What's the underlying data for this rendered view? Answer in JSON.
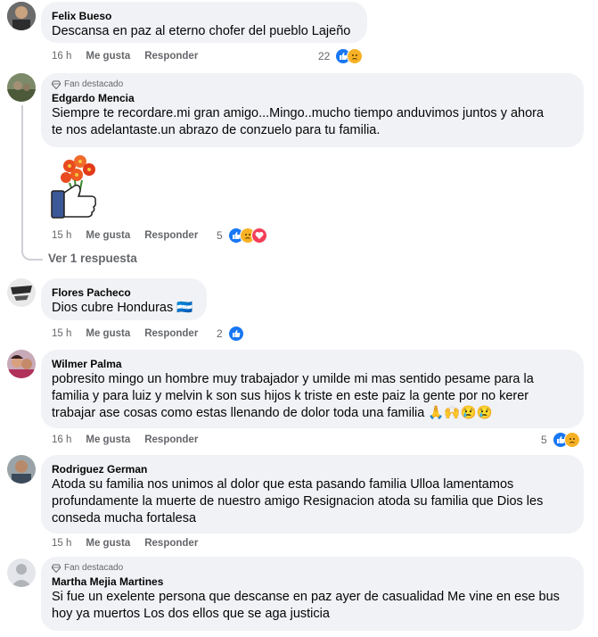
{
  "comments": [
    {
      "name": "Felix Bueso",
      "badge": "",
      "text": [
        "Descansa en paz al eterno chofer del pueblo Lajeño"
      ],
      "time": "16 h",
      "like": "Me gusta",
      "reply": "Responder",
      "count": "22"
    },
    {
      "name": "Edgardo Mencia",
      "badge": "Fan destacado",
      "text": [
        "Siempre te recordare.mi gran amigo...Mingo..mucho tiempo anduvimos juntos y ahora",
        "te nos adelantaste.un abrazo de conzuelo para tu familia."
      ],
      "time": "15 h",
      "like": "Me gusta",
      "reply": "Responder",
      "count": "5",
      "replies_link": "Ver 1 respuesta"
    },
    {
      "name": "Flores Pacheco",
      "badge": "",
      "text": [
        "Dios cubre Honduras 🇭🇳"
      ],
      "time": "15 h",
      "like": "Me gusta",
      "reply": "Responder",
      "count": "2"
    },
    {
      "name": "Wilmer Palma",
      "badge": "",
      "text": [
        "pobresito mingo un hombre muy trabajador y umilde mi mas sentido pesame para la",
        "familia y para luiz y melvin k son sus hijos k triste en este paiz la gente por no kerer",
        "trabajar ase cosas como estas llenando de dolor toda una familia 🙏🙌😢😢"
      ],
      "time": "16 h",
      "like": "Me gusta",
      "reply": "Responder",
      "count": "5"
    },
    {
      "name": "Rodriguez German",
      "badge": "",
      "text": [
        "Atoda su familia nos unimos al dolor que esta pasando familia Ulloa lamentamos",
        "profundamente la muerte de nuestro amigo Resignacion atoda su familia que Dios les",
        "conseda mucha fortalesa"
      ],
      "time": "15 h",
      "like": "Me gusta",
      "reply": "Responder",
      "count": ""
    },
    {
      "name": "Martha Mejia Martines",
      "badge": "Fan destacado",
      "text": [
        "Si fue un exelente persona que descanse en paz ayer de casualidad Me vine en ese bus",
        "hoy ya muertos Los dos ellos que se aga justicia"
      ],
      "time": "",
      "like": "",
      "reply": "",
      "count": ""
    }
  ],
  "icons": {
    "like": "like-icon",
    "sad": "sad-icon",
    "love": "love-icon",
    "diamond": "diamond-icon"
  }
}
